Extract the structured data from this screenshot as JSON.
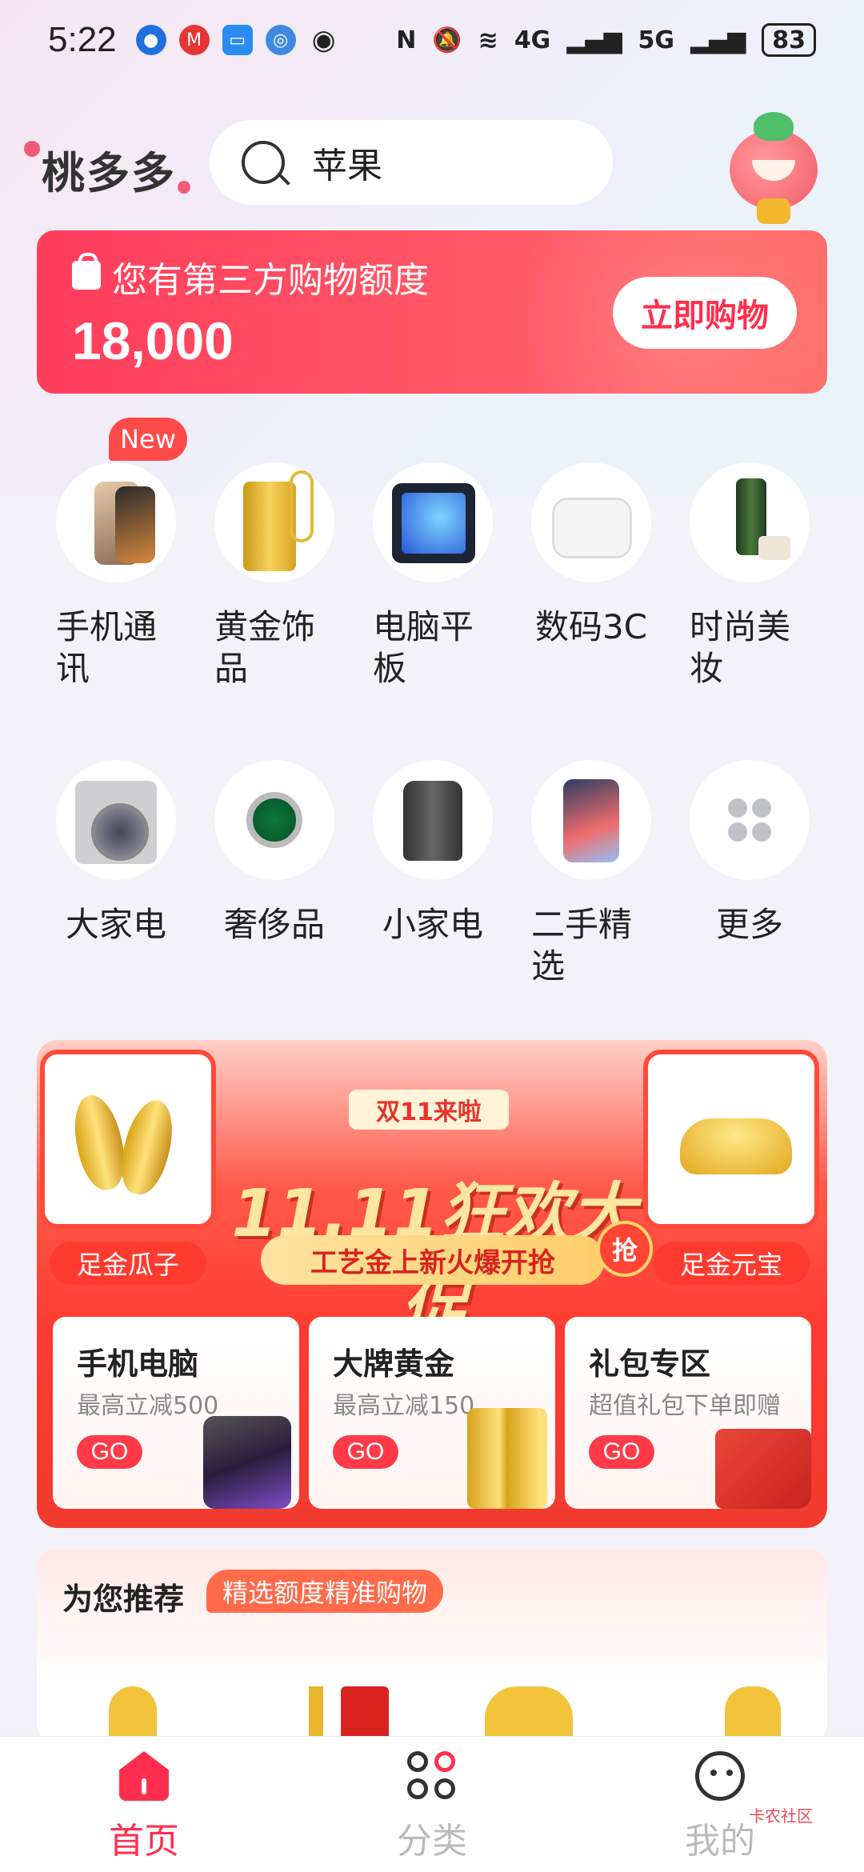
{
  "status_bar": {
    "time": "5:22",
    "network_4g": "4G",
    "network_5g": "5G",
    "battery": "83"
  },
  "header": {
    "logo": "桃多多",
    "search_query": "苹果"
  },
  "credit": {
    "title": "您有第三方购物额度",
    "amount": "18,000",
    "button": "立即购物"
  },
  "categories": {
    "new_badge": "New",
    "items": [
      {
        "label": "手机通讯",
        "icon": "phone-icon"
      },
      {
        "label": "黄金饰品",
        "icon": "gold-bar-icon"
      },
      {
        "label": "电脑平板",
        "icon": "tablet-icon"
      },
      {
        "label": "数码3C",
        "icon": "earbuds-icon"
      },
      {
        "label": "时尚美妆",
        "icon": "cosmetics-icon"
      },
      {
        "label": "大家电",
        "icon": "washer-icon"
      },
      {
        "label": "奢侈品",
        "icon": "watch-icon"
      },
      {
        "label": "小家电",
        "icon": "kettle-icon"
      },
      {
        "label": "二手精选",
        "icon": "iphone-icon"
      },
      {
        "label": "更多",
        "icon": "more-icon"
      }
    ]
  },
  "promo": {
    "top_tag": "双11来啦",
    "headline": "11.11狂欢大促",
    "subline": "工艺金上新火爆开抢",
    "grab": "抢",
    "left_label": "足金瓜子",
    "right_label": "足金元宝",
    "cards": [
      {
        "title": "手机电脑",
        "desc": "最高立减500",
        "go": "GO"
      },
      {
        "title": "大牌黄金",
        "desc": "最高立减150",
        "go": "GO"
      },
      {
        "title": "礼包专区",
        "desc": "超值礼包下单即赠",
        "go": "GO"
      }
    ]
  },
  "recommend": {
    "title": "为您推荐",
    "tag": "精选额度精准购物"
  },
  "tabbar": {
    "home": "首页",
    "category": "分类",
    "me": "我的"
  },
  "watermark": "卡农社区",
  "colors": {
    "accent": "#ff2e4f",
    "promo_red": "#ff3b30"
  }
}
